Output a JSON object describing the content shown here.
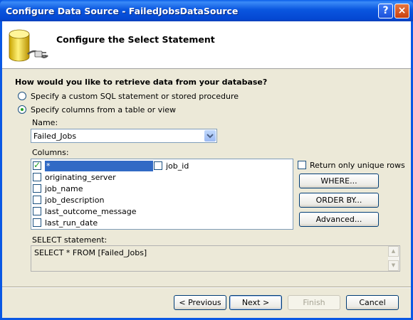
{
  "window": {
    "title": "Configure Data Source - FailedJobsDataSource",
    "help_glyph": "?",
    "close_glyph": "×"
  },
  "header": {
    "title": "Configure the Select Statement",
    "icon": "database-icon"
  },
  "question": "How would you like to retrieve data from your database?",
  "options": [
    {
      "label": "Specify a custom SQL statement or stored procedure",
      "checked": false
    },
    {
      "label": "Specify columns from a table or view",
      "checked": true
    }
  ],
  "name_label": "Name:",
  "table_name": "Failed_Jobs",
  "columns_label": "Columns:",
  "columns": [
    {
      "name": "*",
      "checked": true,
      "selected": true
    },
    {
      "name": "job_id",
      "checked": false
    },
    {
      "name": "originating_server",
      "checked": false
    },
    {
      "name": "job_name",
      "checked": false
    },
    {
      "name": "job_description",
      "checked": false
    },
    {
      "name": "last_outcome_message",
      "checked": false
    },
    {
      "name": "last_run_date",
      "checked": false
    }
  ],
  "unique_rows_label": "Return only unique rows",
  "buttons": {
    "where": "WHERE...",
    "order_by": "ORDER BY...",
    "advanced": "Advanced..."
  },
  "select_label": "SELECT statement:",
  "select_statement": "SELECT * FROM [Failed_Jobs]",
  "footer": {
    "previous": "< Previous",
    "next": "Next >",
    "finish": "Finish",
    "cancel": "Cancel"
  }
}
